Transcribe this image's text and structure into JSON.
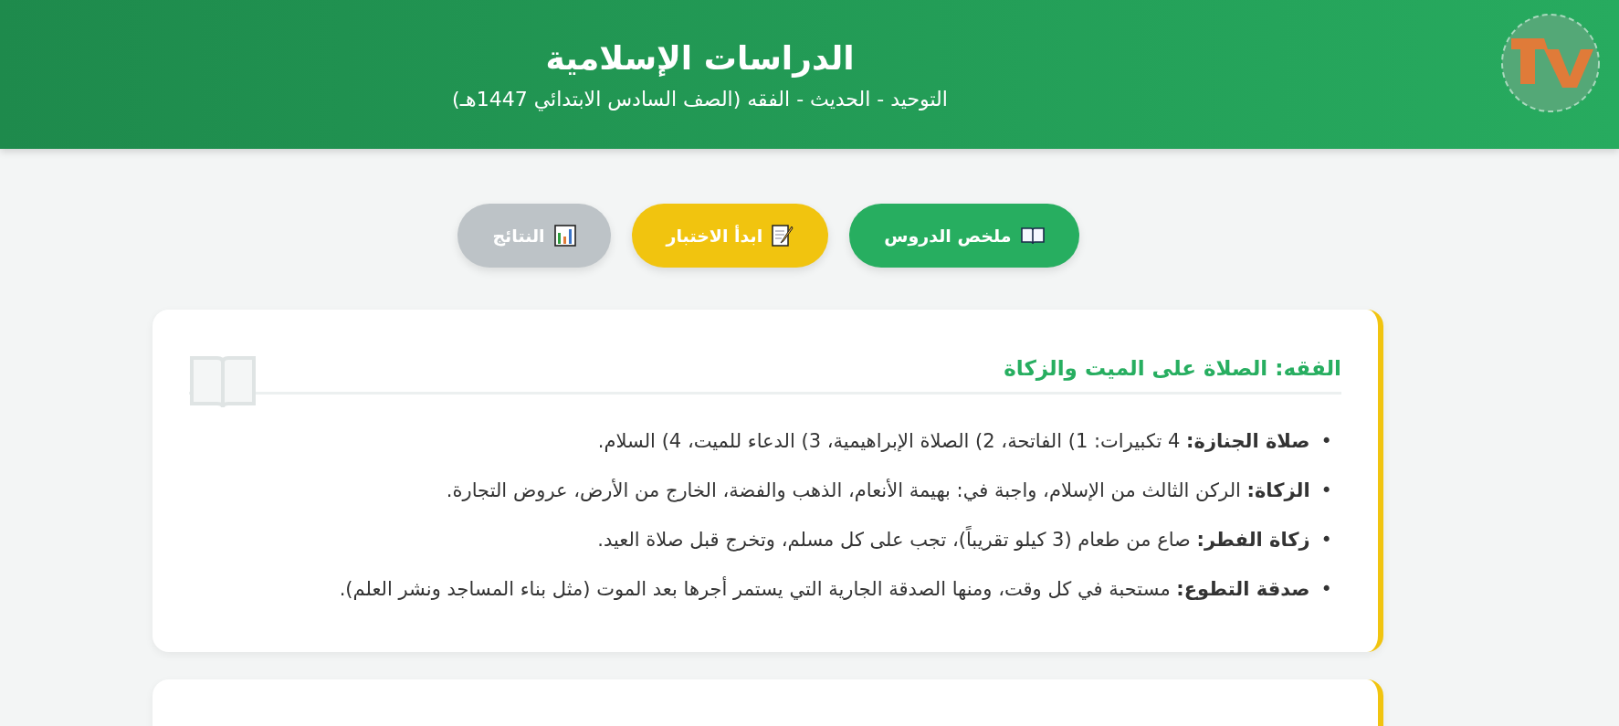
{
  "header": {
    "title": "الدراسات الإسلامية",
    "subtitle": "التوحيد - الحديث - الفقه (الصف السادس الابتدائي 1447هـ)"
  },
  "buttons": [
    {
      "label": "ملخص الدروس",
      "kind": "book",
      "color": "#27ae60"
    },
    {
      "label": "ابدأ الاختبار",
      "kind": "memo",
      "color": "#f1c40f"
    },
    {
      "label": "النتائج",
      "kind": "chart",
      "color": "#bdc3c7"
    }
  ],
  "cards": [
    {
      "kind": "lesson",
      "title": "الفقه: الصلاة على الميت والزكاة",
      "bullet": "•",
      "items": [
        "**صلاة الجنازة:** 4 تكبيرات: 1) الفاتحة، 2) الصلاة الإبراهيمية، 3) الدعاء للميت، 4) السلام.",
        "**الزكاة:** الركن الثالث من الإسلام، واجبة في: بهيمة الأنعام، الذهب والفضة، الخارج من الأرض، عروض التجارة.",
        "**زكاة الفطر:** صاع من طعام (3 كيلو تقريباً)، تجب على كل مسلم، وتخرج قبل صلاة العيد.",
        "**صدقة التطوع:** مستحبة في كل وقت، ومنها الصدقة الجارية التي يستمر أجرها بعد الموت (مثل بناء المساجد ونشر العلم)."
      ]
    },
    {
      "kind": "lesson"
    }
  ]
}
